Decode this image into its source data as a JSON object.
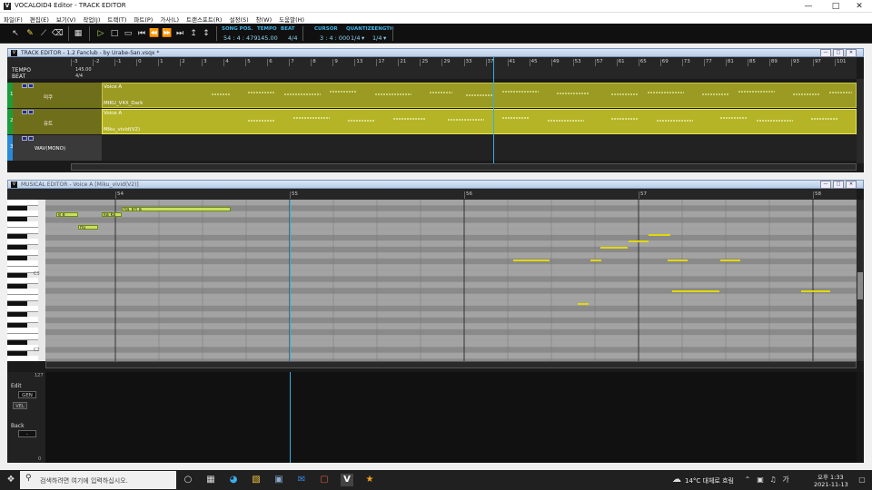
{
  "window": {
    "title": "VOCALOID4 Editor - TRACK EDITOR",
    "icon_letter": "V"
  },
  "menu": [
    "파일(F)",
    "편집(E)",
    "보기(V)",
    "작업(J)",
    "트랙(T)",
    "파트(P)",
    "가사(L)",
    "트랜스포트(R)",
    "설정(S)",
    "창(W)",
    "도움말(H)"
  ],
  "toolbar": {
    "song_pos_label": "SONG POS.",
    "song_pos": "54 : 4 : 479",
    "tempo_label": "TEMPO",
    "tempo": "145.00",
    "beat_label": "BEAT",
    "beat": "4/4",
    "cursor_label": "CURSOR",
    "cursor": "3 : 4 : 000",
    "quantize_label": "QUANTIZE",
    "quantize": "1/4",
    "length_label": "LENGTH",
    "length": "1/4"
  },
  "track_editor": {
    "title": "TRACK EDITOR - 1.2 Fanclub - by Urabe-San.vsqx *",
    "tempo_label": "TEMPO",
    "beat_label": "BEAT",
    "tempo_value": "145.00",
    "beat_value": "4/4",
    "measures": [
      "-3",
      "-2",
      "-1",
      "0",
      "1",
      "2",
      "3",
      "4",
      "5",
      "6",
      "7",
      "8",
      "9",
      "13",
      "17",
      "21",
      "25",
      "29",
      "33",
      "37",
      "41",
      "45",
      "49",
      "53",
      "57",
      "61",
      "65",
      "69",
      "73",
      "77",
      "81",
      "85",
      "89",
      "93",
      "97",
      "101"
    ],
    "tracks": [
      {
        "num": "1",
        "name": "미쿠",
        "part_label": "Voice A",
        "voice": "MIKU_V4X_Dark",
        "color": "#1a9c3a"
      },
      {
        "num": "2",
        "name": "유트",
        "part_label": "Voice A",
        "voice": "Miku_vivid(V2)",
        "color": "#1a9c3a"
      },
      {
        "num": "3",
        "name": "WAV(MONO)",
        "part_label": "",
        "voice": "",
        "color": "#2a8ad8"
      }
    ]
  },
  "musical_editor": {
    "title": "MUSICAL EDITOR - Voice A [Miku_vivid(V2)]",
    "measures": [
      "54",
      "55",
      "56",
      "57",
      "58"
    ],
    "octave_labels": [
      "C3",
      "C2"
    ],
    "notes": [
      {
        "lyric": "e e",
        "row": 0
      },
      {
        "lyric": "nu",
        "row": 1
      },
      {
        "lyric": "ka ka",
        "row": 0
      },
      {
        "lyric": "na",
        "row": 0
      },
      {
        "lyric": "n a",
        "row": 0
      }
    ]
  },
  "control_panel": {
    "max_value": "127",
    "min_value": "0",
    "edit_label": "Edit",
    "edit_value": "GEN",
    "vel_label": "VEL",
    "back_label": "Back",
    "back_value": "-"
  },
  "taskbar": {
    "search_placeholder": "검색하려면 여기에 입력하십시오.",
    "weather": "14°C 대체로 흐림",
    "ime": "가",
    "time": "오후 1:33",
    "date": "2021-11-13"
  }
}
